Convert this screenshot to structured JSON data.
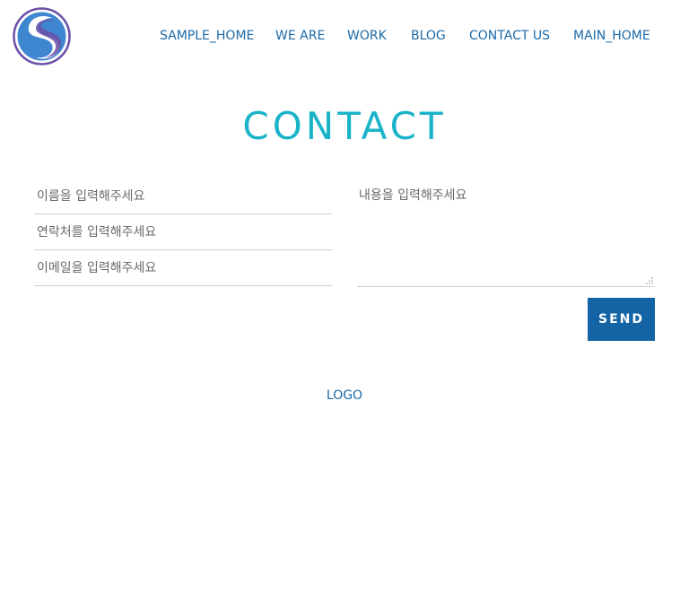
{
  "header": {
    "logo_icon": "s-logo-icon",
    "nav": [
      {
        "label": "SAMPLE_HOME"
      },
      {
        "label": "WE ARE"
      },
      {
        "label": "WORK"
      },
      {
        "label": "BLOG"
      },
      {
        "label": "CONTACT US"
      },
      {
        "label": "MAIN_HOME"
      }
    ]
  },
  "main": {
    "title": "CONTACT",
    "form": {
      "name_placeholder": "이름을 입력해주세요",
      "phone_placeholder": "연락처를 입력해주세요",
      "email_placeholder": "이메일을 입력해주세요",
      "message_placeholder": "내용을 입력해주세요",
      "send_label": "SEND"
    }
  },
  "footer": {
    "logo_text": "LOGO"
  },
  "colors": {
    "nav_text": "#1c6aa8",
    "title": "#1bb3c8",
    "button_bg": "#1464a5",
    "logo_ring": "#6a4fa8",
    "logo_blue": "#3f86d0"
  }
}
